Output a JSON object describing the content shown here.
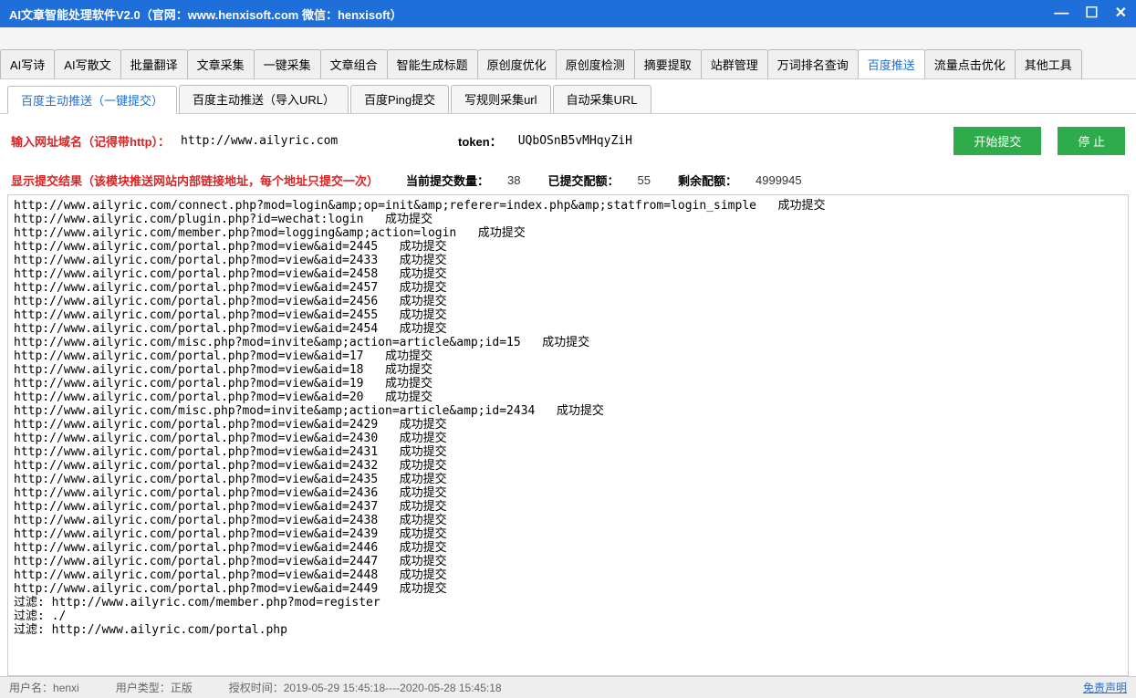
{
  "window": {
    "title": "AI文章智能处理软件V2.0（官网：www.henxisoft.com  微信：henxisoft）"
  },
  "main_tabs": [
    "AI写诗",
    "AI写散文",
    "批量翻译",
    "文章采集",
    "一键采集",
    "文章组合",
    "智能生成标题",
    "原创度优化",
    "原创度检测",
    "摘要提取",
    "站群管理",
    "万词排名查询",
    "百度推送",
    "流量点击优化",
    "其他工具"
  ],
  "main_tab_active": 12,
  "sub_tabs": [
    "百度主动推送（一键提交）",
    "百度主动推送（导入URL）",
    "百度Ping提交",
    "写规则采集url",
    "自动采集URL"
  ],
  "sub_tab_active": 0,
  "input": {
    "label": "输入网址域名（记得带http）：",
    "value": "http://www.ailyric.com",
    "token_label": "token：",
    "token_value": "UQbOSnB5vMHqyZiH",
    "btn_start": "开始提交",
    "btn_stop": "停 止"
  },
  "stats": {
    "label": "显示提交结果（该模块推送网站内部链接地址，每个地址只提交一次）",
    "current_label": "当前提交数量：",
    "current_value": "38",
    "submitted_label": "已提交配额：",
    "submitted_value": "55",
    "remain_label": "剩余配额：",
    "remain_value": "4999945"
  },
  "log": [
    "http://www.ailyric.com/connect.php?mod=login&amp;op=init&amp;referer=index.php&amp;statfrom=login_simple   成功提交",
    "http://www.ailyric.com/plugin.php?id=wechat:login   成功提交",
    "http://www.ailyric.com/member.php?mod=logging&amp;action=login   成功提交",
    "http://www.ailyric.com/portal.php?mod=view&aid=2445   成功提交",
    "http://www.ailyric.com/portal.php?mod=view&aid=2433   成功提交",
    "http://www.ailyric.com/portal.php?mod=view&aid=2458   成功提交",
    "http://www.ailyric.com/portal.php?mod=view&aid=2457   成功提交",
    "http://www.ailyric.com/portal.php?mod=view&aid=2456   成功提交",
    "http://www.ailyric.com/portal.php?mod=view&aid=2455   成功提交",
    "http://www.ailyric.com/portal.php?mod=view&aid=2454   成功提交",
    "http://www.ailyric.com/misc.php?mod=invite&amp;action=article&amp;id=15   成功提交",
    "http://www.ailyric.com/portal.php?mod=view&aid=17   成功提交",
    "http://www.ailyric.com/portal.php?mod=view&aid=18   成功提交",
    "http://www.ailyric.com/portal.php?mod=view&aid=19   成功提交",
    "http://www.ailyric.com/portal.php?mod=view&aid=20   成功提交",
    "http://www.ailyric.com/misc.php?mod=invite&amp;action=article&amp;id=2434   成功提交",
    "http://www.ailyric.com/portal.php?mod=view&aid=2429   成功提交",
    "http://www.ailyric.com/portal.php?mod=view&aid=2430   成功提交",
    "http://www.ailyric.com/portal.php?mod=view&aid=2431   成功提交",
    "http://www.ailyric.com/portal.php?mod=view&aid=2432   成功提交",
    "http://www.ailyric.com/portal.php?mod=view&aid=2435   成功提交",
    "http://www.ailyric.com/portal.php?mod=view&aid=2436   成功提交",
    "http://www.ailyric.com/portal.php?mod=view&aid=2437   成功提交",
    "http://www.ailyric.com/portal.php?mod=view&aid=2438   成功提交",
    "http://www.ailyric.com/portal.php?mod=view&aid=2439   成功提交",
    "http://www.ailyric.com/portal.php?mod=view&aid=2446   成功提交",
    "http://www.ailyric.com/portal.php?mod=view&aid=2447   成功提交",
    "http://www.ailyric.com/portal.php?mod=view&aid=2448   成功提交",
    "http://www.ailyric.com/portal.php?mod=view&aid=2449   成功提交",
    "",
    "过滤: http://www.ailyric.com/member.php?mod=register",
    "过滤: ./",
    "过滤: http://www.ailyric.com/portal.php"
  ],
  "statusbar": {
    "user_label": "用户名：",
    "user_value": "henxi",
    "type_label": "用户类型：",
    "type_value": "正版",
    "auth_label": "授权时间：",
    "auth_value": "2019-05-29 15:45:18----2020-05-28 15:45:18",
    "disclaimer": "免责声明"
  }
}
